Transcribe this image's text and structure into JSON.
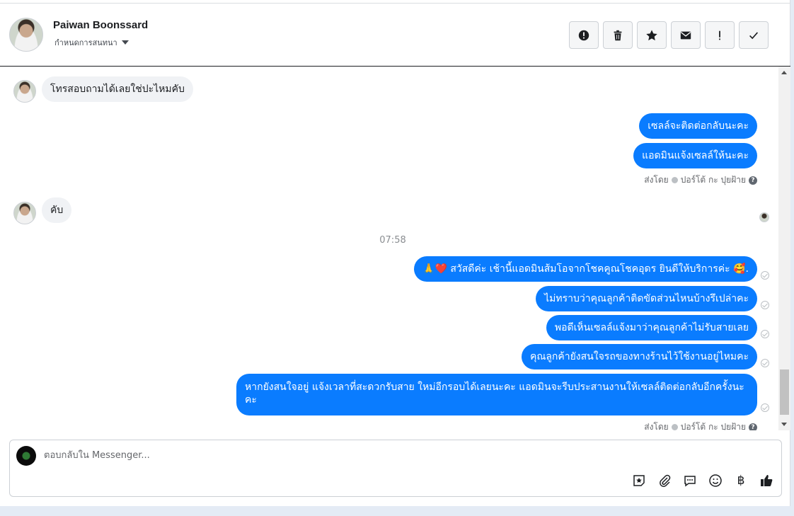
{
  "header": {
    "name": "Paiwan Boonssard",
    "assign_label": "กำหนดการสนทนา",
    "actions": [
      {
        "icon": "alert-circle-icon"
      },
      {
        "icon": "trash-icon"
      },
      {
        "icon": "star-icon"
      },
      {
        "icon": "envelope-icon"
      },
      {
        "icon": "exclamation-icon"
      },
      {
        "icon": "check-icon"
      }
    ]
  },
  "messages": {
    "in_1": "โทรสอบถามได้เลยใช่ปะไหมคับ",
    "out_1": "เซลล์จะติดต่อกลับนะคะ",
    "out_2": "แอดมินแจ้งเซลล์ให้นะคะ",
    "sent_by_1": {
      "prefix": "ส่งโดย",
      "name": "ปอร์โต้ กะ ปุยฝ้าย"
    },
    "in_2": "คับ",
    "time": "07:58",
    "out_3": "🙏❤️ สวัสดีค่ะ เช้านี้แอดมินส้มโอจากโชคคูณโชคอุดร ยินดีให้บริการค่ะ 🥰.",
    "out_4": "ไม่ทราบว่าคุณลูกค้าติดขัดส่วนไหนบ้างรึเปล่าคะ",
    "out_5": "พอดีเห็นเซลล์แจ้งมาว่าคุณลูกค้าไม่รับสายเลย",
    "out_6": "คุณลูกค้ายังสนใจรถของทางร้านไว้ใช้งานอยู่ไหมคะ",
    "out_7": "หากยังสนใจอยู่ แจ้งเวลาที่สะดวกรับสาย ใหม่อีกรอบได้เลยนะคะ แอดมินจะรีบประสานงานให้เซลล์ติดต่อกลับอีกครั้งนะคะ",
    "sent_by_2": {
      "prefix": "ส่งโดย",
      "name": "ปอร์โต้ กะ ปุยฝ้าย"
    }
  },
  "composer": {
    "placeholder": "ตอบกลับใน Messenger...",
    "tools": [
      "sticker-icon",
      "paperclip-icon",
      "chat-bubble-icon",
      "emoji-icon",
      "baht-icon",
      "thumbs-up-icon"
    ],
    "baht_symbol": "฿"
  },
  "colors": {
    "outgoing": "#0a7cff",
    "incoming": "#f0f2f5"
  }
}
